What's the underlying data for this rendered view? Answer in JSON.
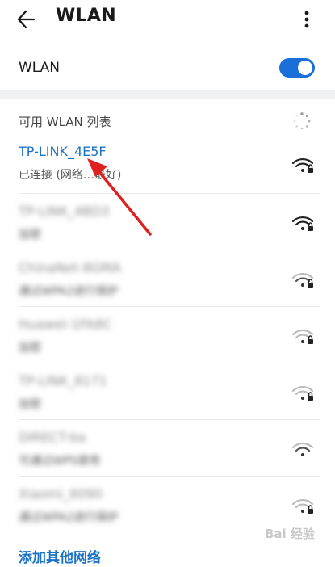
{
  "header": {
    "title": "WLAN",
    "back_icon": "back-arrow-icon",
    "menu_icon": "more-vert-icon"
  },
  "wlan_toggle": {
    "label": "WLAN",
    "state": "on",
    "accent": "#1a6fd8"
  },
  "available": {
    "section_title": "可用 WLAN 列表",
    "loading_icon": "spinner-icon"
  },
  "networks": [
    {
      "name": "TP-LINK_4E5F",
      "status": "已连接 (网络…最好)",
      "signal": "full",
      "locked": true
    },
    {
      "name": "TP-LINK_4BD3",
      "status": "加密",
      "signal": "full",
      "locked": true
    },
    {
      "name": "ChinaNet-8GMA",
      "status": "通过WPA2进行保护",
      "signal": "weak",
      "locked": true
    },
    {
      "name": "Huawei-1FA8C",
      "status": "加密",
      "signal": "weak",
      "locked": true
    },
    {
      "name": "TP-LINK_8171",
      "status": "加密",
      "signal": "weak",
      "locked": true
    },
    {
      "name": "DIRECT-ba",
      "status": "可通过WPS使用",
      "signal": "weak",
      "locked": false
    },
    {
      "name": "Xiaomi_6090",
      "status": "通过WPA2进行保护",
      "signal": "weak",
      "locked": true
    }
  ],
  "add_network": {
    "label": "添加其他网络"
  },
  "colors": {
    "link": "#1a73c9",
    "annotation_arrow": "#e02020"
  },
  "watermark": {
    "text": "Bai 经验"
  }
}
